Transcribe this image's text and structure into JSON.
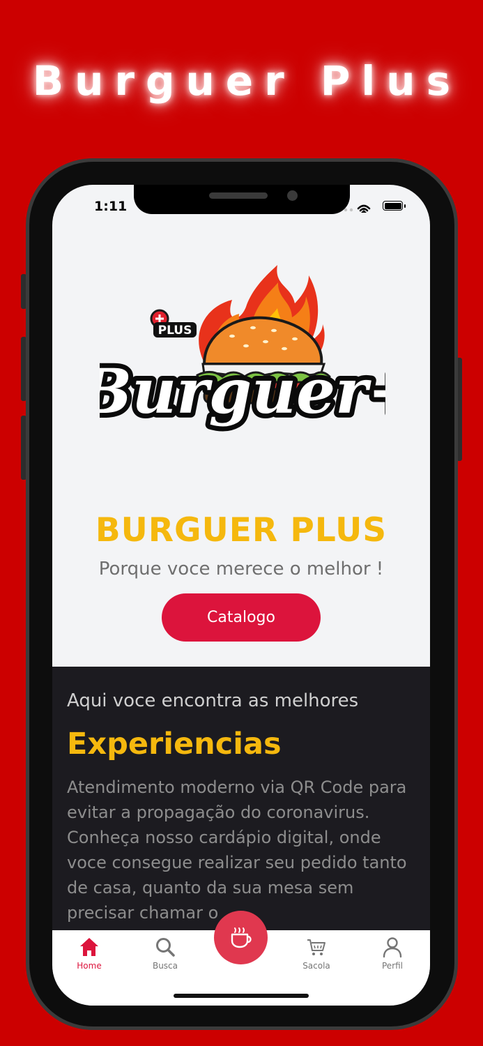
{
  "banner": {
    "title": "Burguer Plus"
  },
  "status_bar": {
    "time": "1:11"
  },
  "logo": {
    "badge_text": "PLUS",
    "script_text": "Burguer+"
  },
  "hero": {
    "title": "BURGUER PLUS",
    "tagline": "Porque voce merece o melhor !",
    "button_label": "Catalogo"
  },
  "info": {
    "lead": "Aqui voce encontra as melhores",
    "heading": "Experiencias",
    "body": "Atendimento moderno via QR Code para evitar a propagação do coronavirus. Conheça nosso cardápio digital, onde voce consegue realizar seu pedido tanto de casa, quanto da sua mesa sem precisar chamar o"
  },
  "tabbar": {
    "items": [
      {
        "label": "Home",
        "icon": "home-icon",
        "active": true
      },
      {
        "label": "Busca",
        "icon": "search-icon",
        "active": false
      },
      {
        "label": "Sacola",
        "icon": "cart-icon",
        "active": false
      },
      {
        "label": "Perfil",
        "icon": "user-icon",
        "active": false
      }
    ],
    "center_icon": "coffee-cup-icon"
  },
  "colors": {
    "background": "#cc0000",
    "accent": "#dc143c",
    "brand_yellow": "#f5b80e",
    "dark_section": "#1c1b20"
  }
}
